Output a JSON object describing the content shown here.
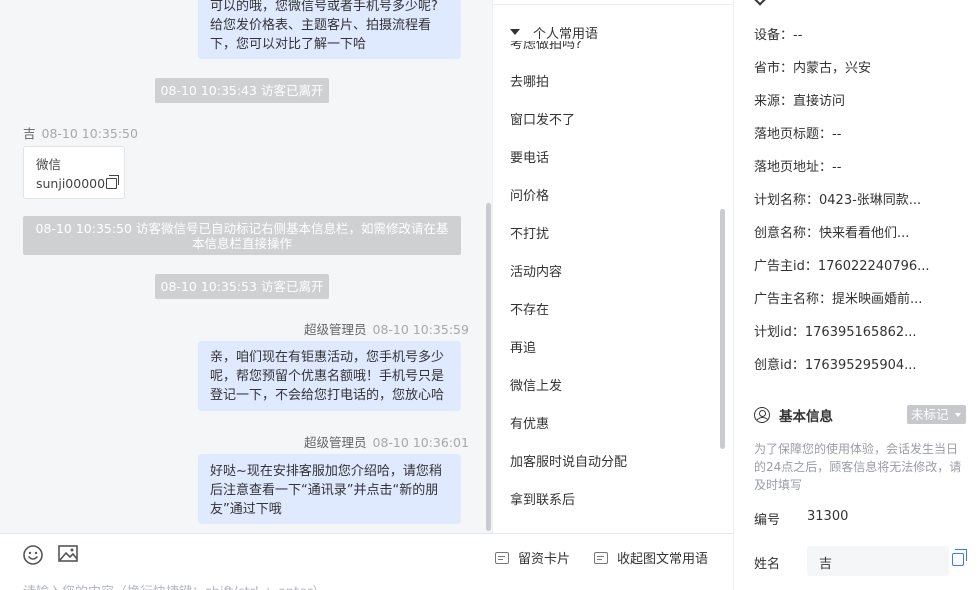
{
  "chat": {
    "msg1_lines": [
      "可以的哦，您微信号或者手机号多少呢?",
      "给您发价格表、主题客片、拍摄流程看",
      "下，您可以对比了解一下哈"
    ],
    "sys_left1": "08-10 10:35:43 访客已离开",
    "visitor_name": "吉",
    "visitor_time": "08-10 10:35:50",
    "card_title": "微信",
    "card_value": "sunji00000",
    "sys_auto_lines": [
      "08-10 10:35:50 访客微信号已自动标记右侧基本信息栏，如需修改请在基",
      "本信息栏直接操作"
    ],
    "sys_left2": "08-10 10:35:53 访客已离开",
    "admin_name": "超级管理员",
    "admin_time1": "08-10 10:35:59",
    "msg2_lines": [
      "亲，咱们现在有钜惠活动，您手机号多少",
      "呢，帮您预留个优惠名额哦！手机号只是",
      "登记一下，不会给您打电话的，您放心哈"
    ],
    "admin_time2": "08-10 10:36:01",
    "msg3_lines": [
      "好哒~现在安排客服加您介绍哈，请您稍",
      "后注意查看一下“通讯录”并点击“新的朋",
      "友”通过下哦"
    ]
  },
  "input": {
    "leave_card": "留资卡片",
    "collapse_phrases": "收起图文常用语",
    "placeholder": "请输入您的内容（换行快捷键：shift/ctrl + enter）"
  },
  "phrases": {
    "header": "个人常用语",
    "cut_item": "考虑做拍吗?",
    "items": [
      "去哪拍",
      "窗口发不了",
      "要电话",
      "问价格",
      "不打扰",
      "活动内容",
      "不存在",
      "再追",
      "微信上发",
      "有优惠",
      "加客服时说自动分配",
      "拿到联系后"
    ]
  },
  "info": {
    "rows": [
      {
        "label": "设备：",
        "value": "--"
      },
      {
        "label": "省市：",
        "value": "内蒙古，兴安"
      },
      {
        "label": "来源：",
        "value": "直接访问"
      },
      {
        "label": "落地页标题：",
        "value": "--"
      },
      {
        "label": "落地页地址：",
        "value": "--"
      },
      {
        "label": "计划名称：",
        "value": "0423-张琳同款..."
      },
      {
        "label": "创意名称：",
        "value": "快来看看他们..."
      },
      {
        "label": "广告主id：",
        "value": "176022240796..."
      },
      {
        "label": "广告主名称：",
        "value": "提米映画婚前..."
      },
      {
        "label": "计划id：",
        "value": "176395165862..."
      },
      {
        "label": "创意id：",
        "value": "176395295904..."
      }
    ],
    "section_title": "基本信息",
    "tag": "未标记",
    "notice": "为了保障您的使用体验，会话发生当日的24点之后，顾客信息将无法修改，请及时填写",
    "id_label": "编号",
    "id_value": "31300",
    "name_label": "姓名",
    "name_value": "吉"
  }
}
